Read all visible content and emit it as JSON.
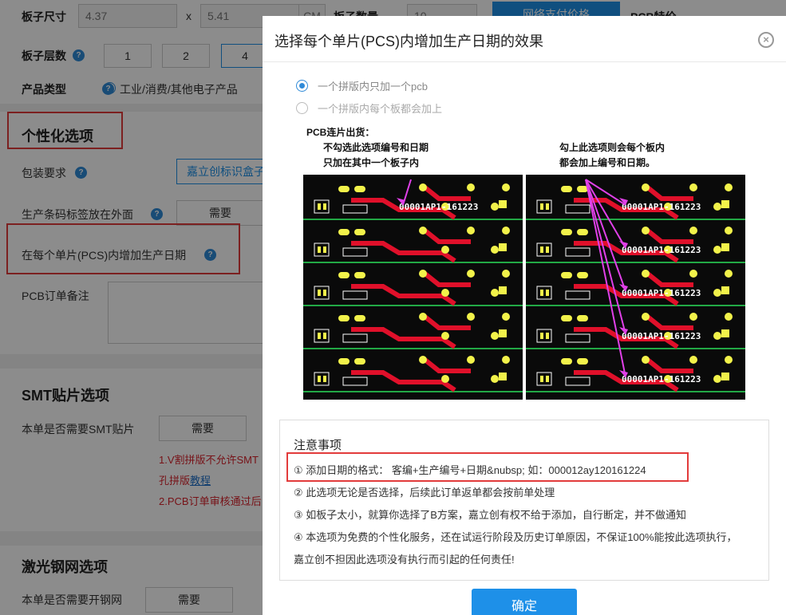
{
  "bg": {
    "board_size_label": "板子尺寸",
    "board_w": "4.37",
    "board_x": "x",
    "board_h": "5.41",
    "board_unit": "CM",
    "board_qty_label": "板子数量",
    "board_qty": "10",
    "price_btn": "网络支付价格",
    "pcb_feature": "PCB特价",
    "layers_label": "板子层数",
    "layer_options": [
      "1",
      "2",
      "4"
    ],
    "product_type_label": "产品类型",
    "product_type_value": "工业/消费/其他电子产品",
    "personal_title": "个性化选项",
    "pack_label": "包装要求",
    "pack_value": "嘉立创标识盒子",
    "barcode_label": "生产条码标签放在外面",
    "barcode_value": "需要",
    "date_label": "在每个单片(PCS)内增加生产日期",
    "remark_label": "PCB订单备注",
    "smt_title": "SMT贴片选项",
    "smt_label": "本单是否需要SMT贴片",
    "smt_value": "需要",
    "smt_note1": "1.V割拼版不允许SMT",
    "smt_note2_prefix": "孔拼版",
    "smt_note2_link": "教程",
    "smt_note3": "2.PCB订单审核通过后",
    "stencil_title": "激光钢网选项",
    "stencil_label": "本单是否需要开钢网",
    "stencil_value": "需要"
  },
  "modal": {
    "title": "选择每个单片(PCS)内增加生产日期的效果",
    "close_glyph": "×",
    "options": [
      {
        "label": "一个拼版内只加一个pcb",
        "selected": true
      },
      {
        "label": "一个拼版内每个板都会加上",
        "selected": false
      }
    ],
    "caption_left_1": "PCB连片出货：",
    "caption_left_2": "不勾选此选项编号和日期",
    "caption_left_3": "只加在其中一个板子内",
    "caption_right_1": "勾上此选项则会每个板内",
    "caption_right_2": "都会加上编号和日期。",
    "board_text": "00001AP1-161223",
    "notice_title": "注意事项",
    "notes": [
      "① 添加日期的格式： 客编+生产编号+日期&nubsp; 如：000012ay120161224",
      "② 此选项无论是否选择，后续此订单返单都会按前单处理",
      "③ 如板子太小，就算你选择了B方案，嘉立创有权不给于添加，自行断定，并不做通知",
      "④ 本选项为免费的个性化服务，还在试运行阶段及历史订单原因，不保证100%能按此选项执行，",
      "嘉立创不担因此选项没有执行而引起的任何责任!"
    ],
    "ok_label": "确定"
  },
  "colors": {
    "accent": "#1e90e8",
    "highlight": "#e23b3b",
    "pcb_board": "#0a0a0a",
    "pcb_trace": "#e0102a",
    "pcb_pad": "#f2f24a",
    "pcb_silk": "#ffffff",
    "pcb_grid": "#22a845",
    "arrow": "#e040e8"
  }
}
